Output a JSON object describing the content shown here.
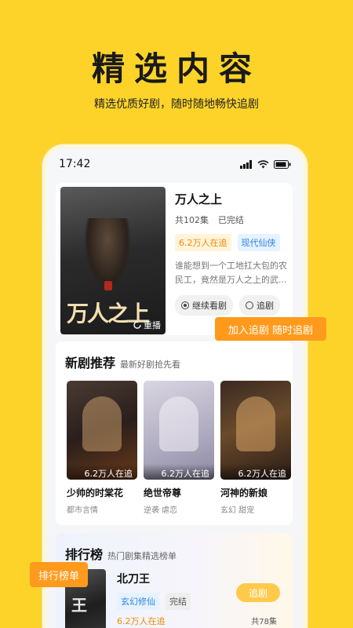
{
  "headline": "精选内容",
  "subline": "精选优质好剧，随时随地畅快追剧",
  "status": {
    "time": "17:42"
  },
  "hero": {
    "title": "万人之上",
    "episodes": "共102集",
    "state": "已完结",
    "tags": [
      "6.2万人在追",
      "现代仙侠"
    ],
    "desc": "谁能想到一个工地扛大包的农民工，竟然是万人之上的武...",
    "poster_text": "万人之上",
    "replay": "重播",
    "continue_btn": "继续看剧",
    "follow_btn": "追剧"
  },
  "add_badge": "加入追剧 随时追剧",
  "new_section": {
    "title": "新剧推荐",
    "subtitle": "最新好剧抢先看",
    "items": [
      {
        "name": "少帅的时棠花",
        "genre": "都市言情",
        "watching": "6.2万人在追"
      },
      {
        "name": "绝世帝尊",
        "genre": "逆袭  虐恋",
        "watching": "6.2万人在追"
      },
      {
        "name": "河神的新娘",
        "genre": "玄幻  甜宠",
        "watching": "6.2万人在追"
      }
    ]
  },
  "rank_section": {
    "title": "排行榜",
    "subtitle": "热门剧集精选榜单",
    "badge": "排行榜单",
    "item": {
      "title": "北刀王",
      "tags": [
        "玄幻修仙",
        "完结"
      ],
      "watching": "6.2万人在追",
      "episodes": "共78集",
      "follow": "追剧",
      "poster_text": "王"
    }
  }
}
